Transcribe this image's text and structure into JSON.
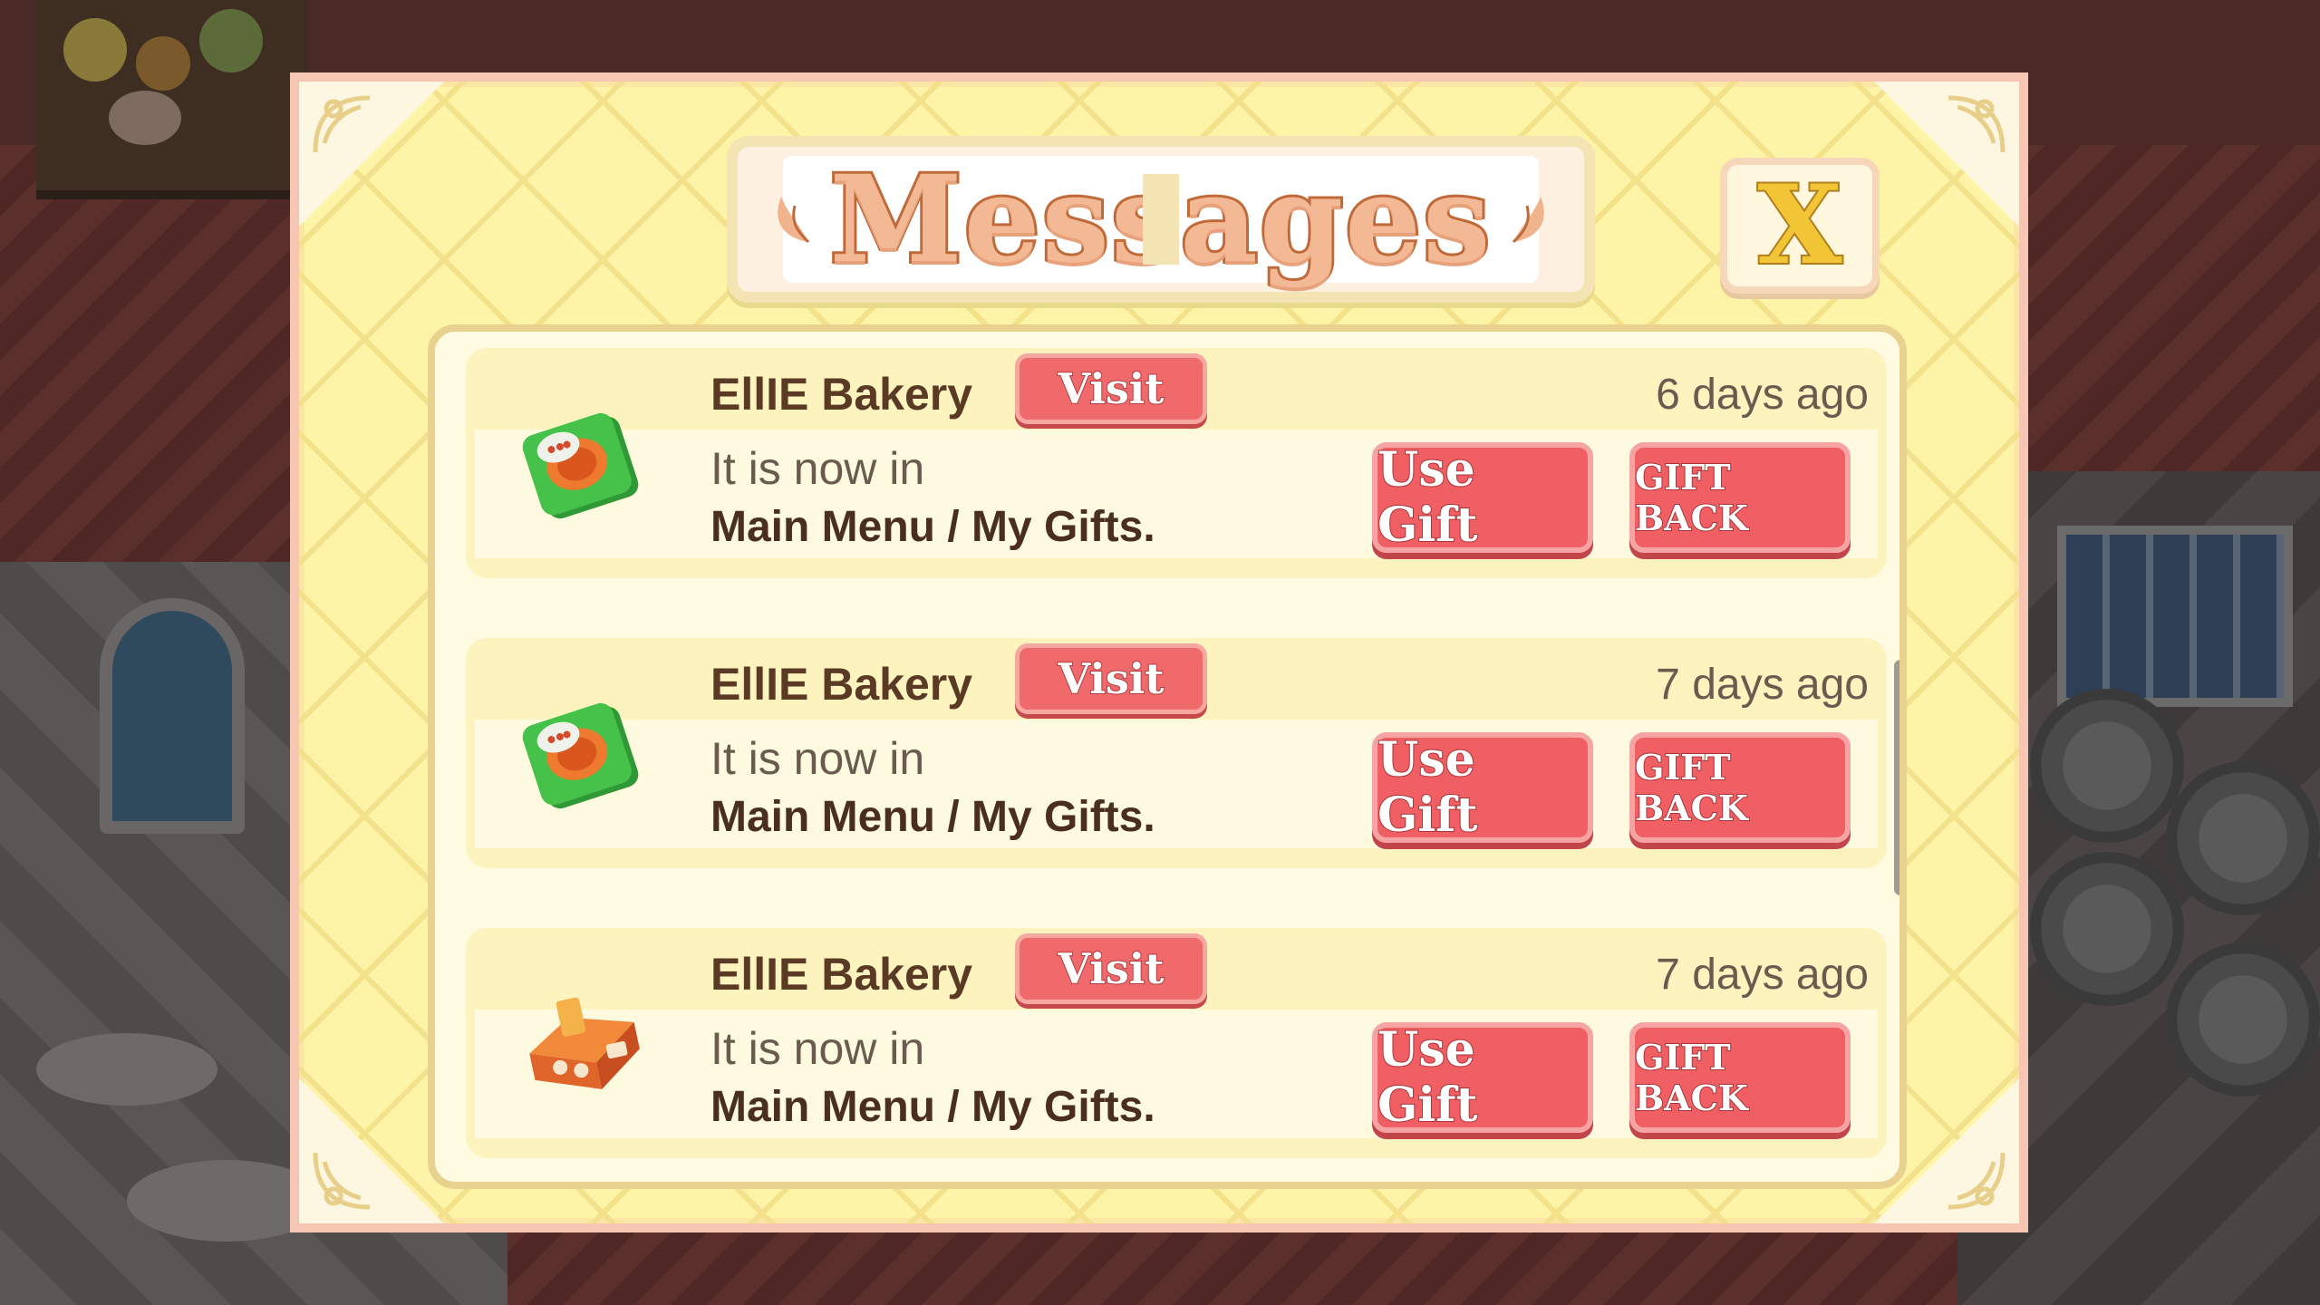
{
  "dialog": {
    "title": "Messages",
    "close_label": "X"
  },
  "messages": [
    {
      "sender": "EllIE Bakery",
      "visit_label": "Visit",
      "time": "6 days ago",
      "line1": "It is now in",
      "line2": "Main Menu / My Gifts.",
      "use_label": "Use Gift",
      "back_label": "GIFT BACK",
      "icon": "green-spool-gift-icon"
    },
    {
      "sender": "EllIE Bakery",
      "visit_label": "Visit",
      "time": "7 days ago",
      "line1": "It is now in",
      "line2": "Main Menu / My Gifts.",
      "use_label": "Use Gift",
      "back_label": "GIFT BACK",
      "icon": "green-spool-gift-icon"
    },
    {
      "sender": "EllIE Bakery",
      "visit_label": "Visit",
      "time": "7 days ago",
      "line1": "It is now in",
      "line2": "Main Menu / My Gifts.",
      "use_label": "Use Gift",
      "back_label": "GIFT BACK",
      "icon": "orange-cabinet-gift-icon"
    }
  ],
  "colors": {
    "dialog_bg": "#fdf4a8",
    "button_red": "#ef5f63",
    "title_peach": "#f3b894",
    "close_yellow": "#f2c537"
  }
}
